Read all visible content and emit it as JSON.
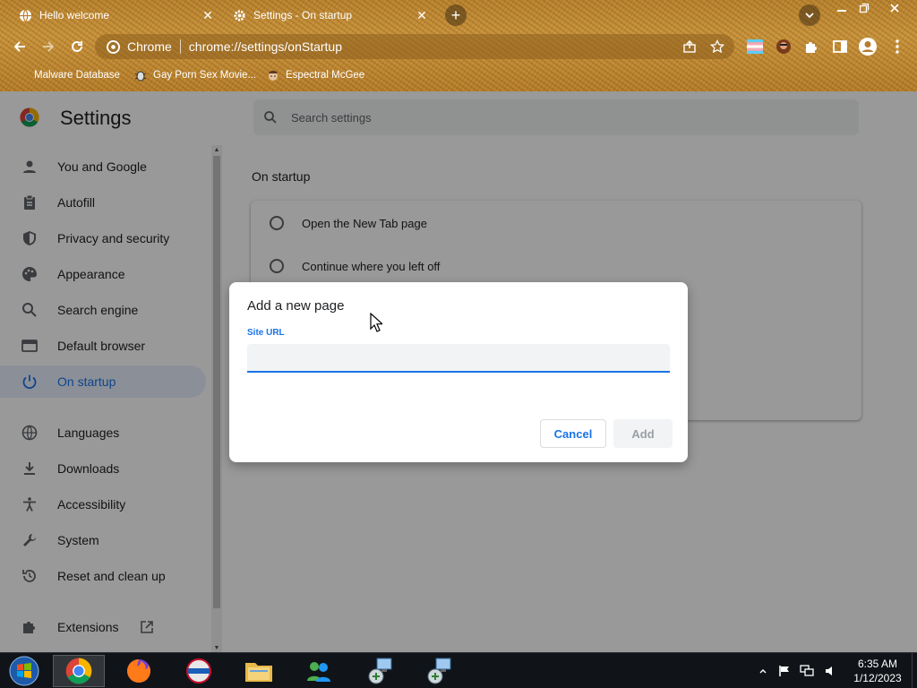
{
  "browser": {
    "tabs": [
      {
        "title": "Hello welcome",
        "icon": "globe-icon",
        "active": false
      },
      {
        "title": "Settings - On startup",
        "icon": "gear-icon",
        "active": true
      }
    ],
    "omnibox": {
      "site_name": "Chrome",
      "url": "chrome://settings/onStartup"
    },
    "bookmarks": [
      {
        "label": "Malware Database",
        "icon": "none"
      },
      {
        "label": "Gay Porn Sex Movie...",
        "icon": "bug-icon"
      },
      {
        "label": "Espectral McGee",
        "icon": "face-icon"
      }
    ]
  },
  "settings": {
    "title": "Settings",
    "search_placeholder": "Search settings",
    "sidebar": [
      {
        "label": "You and Google",
        "icon": "person-icon"
      },
      {
        "label": "Autofill",
        "icon": "clipboard-icon"
      },
      {
        "label": "Privacy and security",
        "icon": "shield-icon"
      },
      {
        "label": "Appearance",
        "icon": "palette-icon"
      },
      {
        "label": "Search engine",
        "icon": "search-icon"
      },
      {
        "label": "Default browser",
        "icon": "browser-icon"
      },
      {
        "label": "On startup",
        "icon": "power-icon",
        "active": true
      },
      {
        "label": "Languages",
        "icon": "globe-icon"
      },
      {
        "label": "Downloads",
        "icon": "download-icon"
      },
      {
        "label": "Accessibility",
        "icon": "accessibility-icon"
      },
      {
        "label": "System",
        "icon": "wrench-icon"
      },
      {
        "label": "Reset and clean up",
        "icon": "history-icon"
      },
      {
        "label": "Extensions",
        "icon": "puzzle-icon"
      }
    ],
    "section_title": "On startup",
    "options": [
      {
        "label": "Open the New Tab page"
      },
      {
        "label": "Continue where you left off"
      }
    ]
  },
  "dialog": {
    "title": "Add a new page",
    "field_label": "Site URL",
    "field_value": "",
    "cancel_label": "Cancel",
    "add_label": "Add"
  },
  "taskbar": {
    "time": "6:35 AM",
    "date": "1/12/2023"
  },
  "colors": {
    "accent": "#1a73e8",
    "active_nav_bg": "#e8f0fe",
    "overlay": "rgba(0,0,0,0.4)"
  }
}
